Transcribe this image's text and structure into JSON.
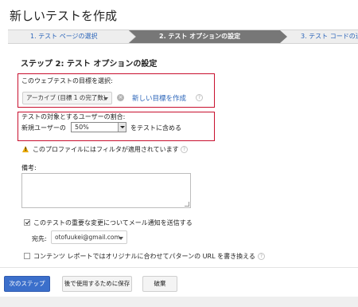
{
  "page": {
    "title": "新しいテストを作成"
  },
  "steps": [
    {
      "label": "1. テスト ページの選択",
      "state": "done"
    },
    {
      "label": "2. テスト オプションの設定",
      "state": "active"
    },
    {
      "label": "3. テスト コードの追",
      "state": "upcoming"
    }
  ],
  "section": {
    "title": "ステップ 2: テスト オプションの設定"
  },
  "goal": {
    "label": "このウェブテストの目標を選択:",
    "selected": "アーカイブ (目標 1 の完了数)",
    "new_goal_link": "新しい目標を作成"
  },
  "traffic": {
    "label": "テストの対象とするユーザーの割合:",
    "prefix": "新規ユーザーの",
    "selected": "50%",
    "suffix": "をテストに含める"
  },
  "warning": {
    "text": "このプロファイルにはフィルタが適用されています"
  },
  "notes": {
    "label": "備考:",
    "value": ""
  },
  "notification": {
    "label": "このテストの重要な変更についてメール通知を送信する",
    "checked": true,
    "to_label": "宛先:",
    "to_selected": "otofuukei@gmail.com"
  },
  "rewrite": {
    "label": "コンテンツ レポートではオリジナルに合わせてパターンの URL を書き換える",
    "checked": false
  },
  "buttons": {
    "next": "次のステップ",
    "save_later": "後で使用するために保存",
    "discard": "破棄"
  },
  "colors": {
    "highlight_border": "#c8102e",
    "primary_button": "#3b6fcb",
    "link": "#2a64b9",
    "warning": "#e9a900"
  }
}
